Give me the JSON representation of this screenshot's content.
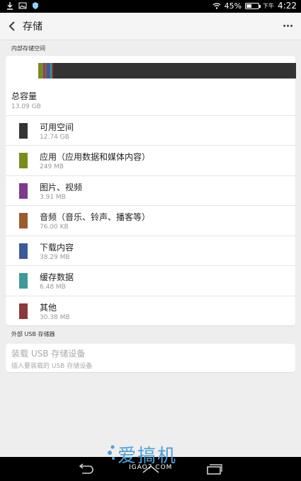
{
  "status_bar": {
    "battery_percent": "45%",
    "time_prefix": "下午",
    "time": "4:22",
    "battery_level": 0.45,
    "icons": [
      "download-icon",
      "image-icon",
      "shield-icon",
      "wifi-icon",
      "battery-icon"
    ]
  },
  "header": {
    "title": "存储"
  },
  "internal": {
    "section_label": "内部存储空间",
    "total_label": "总容量",
    "total_value": "13.09 GB",
    "usage_segments": [
      {
        "name": "apps",
        "fraction": 0.018,
        "color": "#7a8b1e"
      },
      {
        "name": "pictures",
        "fraction": 0.008,
        "color": "#7e3a8c"
      },
      {
        "name": "audio",
        "fraction": 0.008,
        "color": "#8e5a3a"
      },
      {
        "name": "downloads",
        "fraction": 0.012,
        "color": "#3c5a9a"
      },
      {
        "name": "cache",
        "fraction": 0.006,
        "color": "#3e9a9a"
      },
      {
        "name": "misc",
        "fraction": 0.006,
        "color": "#8a3a3a"
      },
      {
        "name": "available",
        "fraction": 0.942,
        "color": "#333333"
      }
    ],
    "items": [
      {
        "label": "可用空间",
        "value": "12.74 GB",
        "color": "#333333"
      },
      {
        "label": "应用（应用数据和媒体内容）",
        "value": "249 MB",
        "color": "#7a8b1e"
      },
      {
        "label": "图片、视频",
        "value": "3.91 MB",
        "color": "#7e3a8c"
      },
      {
        "label": "音频（音乐、铃声、播客等）",
        "value": "76.00 KB",
        "color": "#9a5a2e"
      },
      {
        "label": "下载内容",
        "value": "38.29 MB",
        "color": "#3c5a9a"
      },
      {
        "label": "缓存数据",
        "value": "6.48 MB",
        "color": "#3e9a9a"
      },
      {
        "label": "其他",
        "value": "30.38 MB",
        "color": "#8a3a3a"
      }
    ]
  },
  "external": {
    "section_label": "外部 USB 存储器",
    "mount_title": "装载 USB 存储设备",
    "mount_subtitle": "插入要装载的 USB 存储设备"
  },
  "watermark": {
    "text": "爱搞机",
    "url": "IGAO7.COM"
  }
}
